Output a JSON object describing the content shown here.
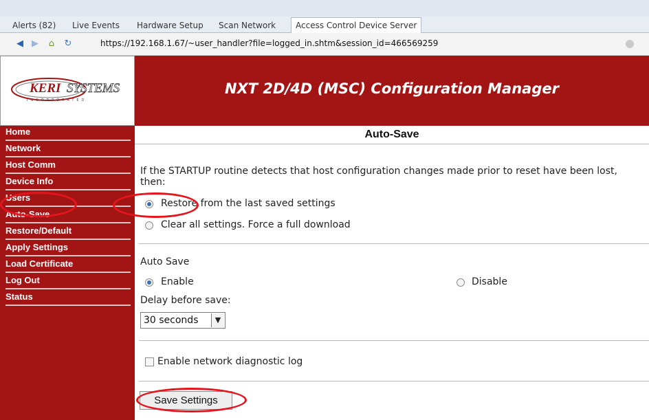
{
  "browser": {
    "tabs": [
      "Alerts (82)",
      "Live Events",
      "Hardware Setup",
      "Scan Network",
      "Access Control Device Server"
    ],
    "address": "https://192.168.1.67/~user_handler?file=logged_in.shtm&session_id=466569259"
  },
  "header": {
    "logo_text": "KERISYSTEMS",
    "logo_tagline": "INCORPORATED",
    "title": "NXT 2D/4D (MSC) Configuration Manager"
  },
  "sidebar": {
    "items": [
      {
        "label": "Home"
      },
      {
        "label": "Network"
      },
      {
        "label": "Host Comm"
      },
      {
        "label": "Device Info"
      },
      {
        "label": "Users"
      },
      {
        "label": "Auto-Save"
      },
      {
        "label": "Restore/Default"
      },
      {
        "label": "Apply Settings"
      },
      {
        "label": "Load Certificate"
      },
      {
        "label": "Log Out"
      },
      {
        "label": "Status"
      }
    ]
  },
  "main": {
    "section_title": "Auto-Save",
    "intro": "If the STARTUP routine detects that host configuration changes made prior to reset have been lost, then:",
    "startup_options": [
      "Restore from the last saved settings",
      "Clear all settings. Force a full download"
    ],
    "startup_selected": 0,
    "auto_save_label": "Auto Save",
    "auto_save_options": [
      "Enable",
      "Disable"
    ],
    "auto_save_selected": 0,
    "delay_label": "Delay before save:",
    "delay_value": "30 seconds",
    "diagnostic_label": "Enable network diagnostic log",
    "diagnostic_checked": false,
    "save_button": "Save Settings"
  },
  "colors": {
    "brand_red": "#a31515",
    "annotation_red": "#e6141c"
  }
}
